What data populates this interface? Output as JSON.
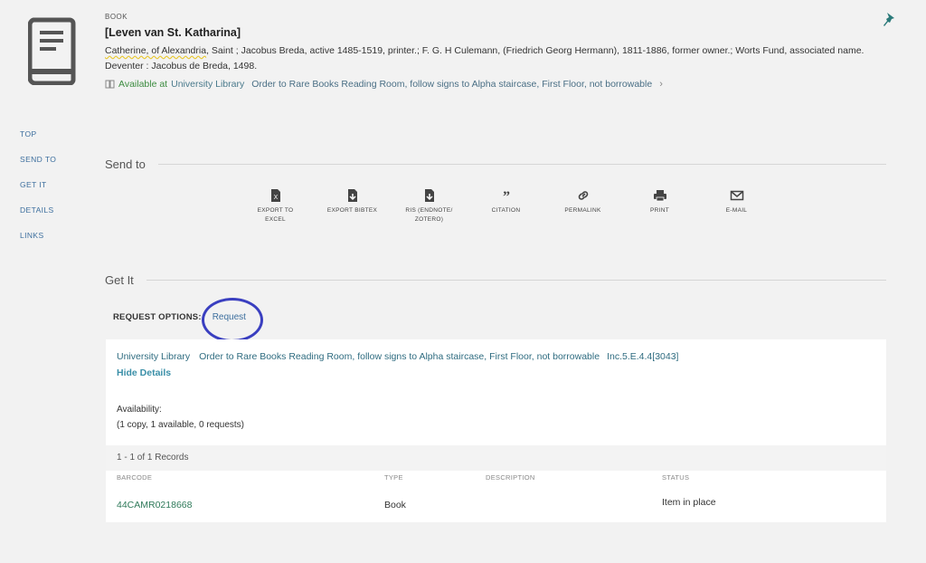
{
  "record": {
    "type": "BOOK",
    "title": "[Leven van St. Katharina]",
    "creator_main": "Catherine, of Alexandria",
    "creators_rest": ", Saint ; Jacobus Breda, active 1485-1519, printer.; F. G. H Culemann, (Friedrich Georg Hermann), 1811-1886, former owner.; Worts Fund, associated name.",
    "publication": "Deventer : Jacobus de Breda, 1498.",
    "availability": {
      "status": "Available at",
      "library": "University Library",
      "location": "Order to Rare Books Reading Room, follow signs to Alpha staircase, First Floor, not borrowable"
    }
  },
  "sidenav": [
    "TOP",
    "SEND TO",
    "GET IT",
    "DETAILS",
    "LINKS"
  ],
  "send_to": {
    "title": "Send to",
    "actions": [
      {
        "label": "EXPORT TO EXCEL",
        "icon": "excel-icon"
      },
      {
        "label": "EXPORT BIBTEX",
        "icon": "bibtex-icon"
      },
      {
        "label": "RIS (ENDNOTE/ ZOTERO)",
        "icon": "ris-icon"
      },
      {
        "label": "CITATION",
        "icon": "quote-icon"
      },
      {
        "label": "PERMALINK",
        "icon": "link-icon"
      },
      {
        "label": "PRINT",
        "icon": "printer-icon"
      },
      {
        "label": "E-MAIL",
        "icon": "envelope-icon"
      }
    ]
  },
  "get_it": {
    "title": "Get It",
    "request_options_label": "REQUEST OPTIONS:",
    "request_link": "Request",
    "holding": {
      "library": "University Library",
      "location": "Order to Rare Books Reading Room, follow signs to Alpha staircase, First Floor, not borrowable",
      "call_number": "Inc.5.E.4.4[3043]"
    },
    "hide_details": "Hide Details",
    "availability_label": "Availability:",
    "availability_value": "(1 copy, 1 available, 0 requests)",
    "records_count": "1 - 1 of 1 Records",
    "columns": {
      "barcode": "BARCODE",
      "type": "TYPE",
      "description": "DESCRIPTION",
      "status": "STATUS"
    },
    "items": [
      {
        "barcode": "44CAMR0218668",
        "type": "Book",
        "description": "",
        "status": "Item in place"
      }
    ]
  },
  "colors": {
    "accent_circle": "#3a3fc0",
    "available_green": "#3d8c40",
    "link_blue": "#3d6f9e"
  }
}
